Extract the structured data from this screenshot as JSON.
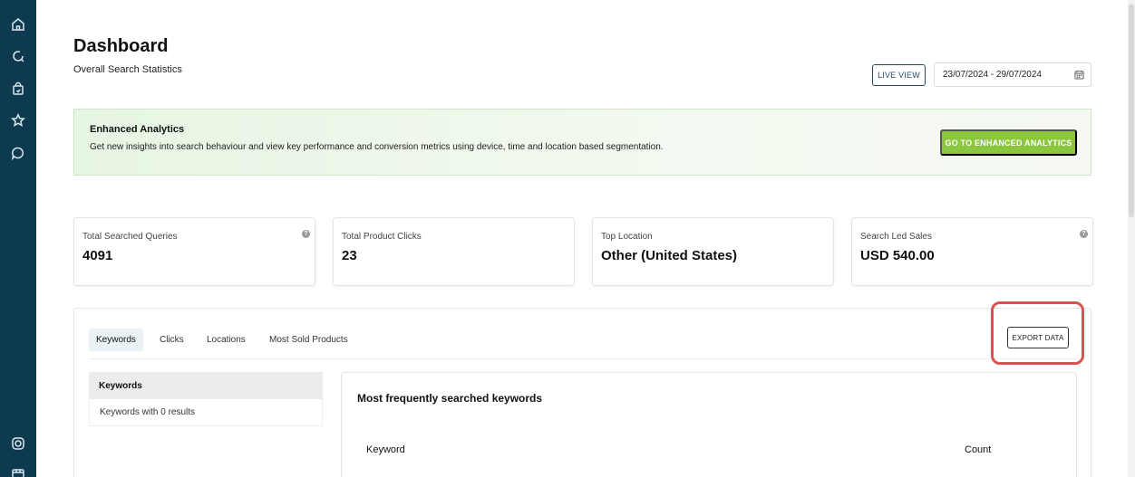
{
  "page": {
    "title": "Dashboard",
    "subtitle": "Overall Search Statistics"
  },
  "header": {
    "live_view_label": "LIVE VIEW",
    "date_range": "23/07/2024 - 29/07/2024"
  },
  "banner": {
    "title": "Enhanced Analytics",
    "text": "Get new insights into search behaviour and view key performance and conversion metrics using device, time and location based segmentation.",
    "button_label": "GO TO ENHANCED ANALYTICS"
  },
  "stats": [
    {
      "label": "Total Searched Queries",
      "value": "4091",
      "help": "?"
    },
    {
      "label": "Total Product Clicks",
      "value": "23"
    },
    {
      "label": "Top Location",
      "value": "Other (United States)"
    },
    {
      "label": "Search Led Sales",
      "value": "USD 540.00",
      "help": "?"
    }
  ],
  "tabs": [
    {
      "label": "Keywords",
      "active": true
    },
    {
      "label": "Clicks"
    },
    {
      "label": "Locations"
    },
    {
      "label": "Most Sold Products"
    }
  ],
  "export_label": "EXPORT DATA",
  "sub_menu": [
    {
      "label": "Keywords",
      "active": true
    },
    {
      "label": "Keywords with 0 results"
    }
  ],
  "keywords_card": {
    "title": "Most frequently searched keywords",
    "columns": [
      "Keyword",
      "Count"
    ]
  },
  "sidebar_icons": [
    "home-icon",
    "search-icon",
    "shopping-bag-icon",
    "star-icon",
    "chat-icon",
    "instagram-icon",
    "store-icon"
  ],
  "colors": {
    "sidebar": "#0d3a4f",
    "accent_green": "#8cc63f",
    "highlight_red": "#d9534f"
  }
}
